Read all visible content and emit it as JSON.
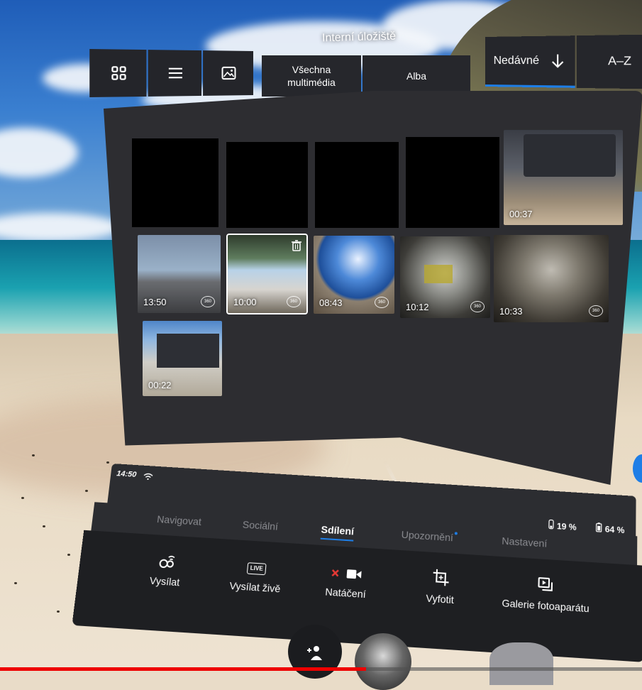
{
  "header": {
    "title": "Interní úložiště"
  },
  "view_modes": [
    {
      "name": "grid-view-icon"
    },
    {
      "name": "list-view-icon"
    },
    {
      "name": "image-view-icon"
    }
  ],
  "filters": [
    {
      "label": "Všechna multimédia"
    },
    {
      "label": "Alba"
    }
  ],
  "sort": {
    "recent_label": "Nedávné",
    "az_label": "A–Z",
    "direction_icon": "arrow-down-icon"
  },
  "gallery": {
    "empty_tiles": 4,
    "items": [
      {
        "duration": "00:37",
        "is360": false
      },
      {
        "duration": "13:50",
        "is360": true
      },
      {
        "duration": "10:00",
        "is360": true,
        "selected": true
      },
      {
        "duration": "08:43",
        "is360": true
      },
      {
        "duration": "10:12",
        "is360": true
      },
      {
        "duration": "10:33",
        "is360": true
      },
      {
        "duration": "00:22",
        "is360": false
      }
    ],
    "badge_text": "360"
  },
  "system_bar": {
    "time": "14:50",
    "controller_battery": "19 %",
    "headset_battery": "64 %",
    "tabs": [
      {
        "label": "Navigovat"
      },
      {
        "label": "Sociální"
      },
      {
        "label": "Sdílení",
        "active": true
      },
      {
        "label": "Upozornění",
        "has_dot": true
      },
      {
        "label": "Nastavení"
      }
    ],
    "actions": [
      {
        "label": "Vysílat",
        "icon": "cast-icon"
      },
      {
        "label": "Vysílat živě",
        "icon": "live-icon",
        "badge": "LIVE"
      },
      {
        "label": "Natáčení",
        "icon": "record-icon"
      },
      {
        "label": "Vyfotit",
        "icon": "crop-capture-icon"
      },
      {
        "label": "Galerie fotoaparátu",
        "icon": "gallery-icon"
      }
    ]
  },
  "colors": {
    "accent": "#1e7ee6",
    "panel": "#2d2d31",
    "record": "#e53935"
  },
  "video_progress": 0.57
}
